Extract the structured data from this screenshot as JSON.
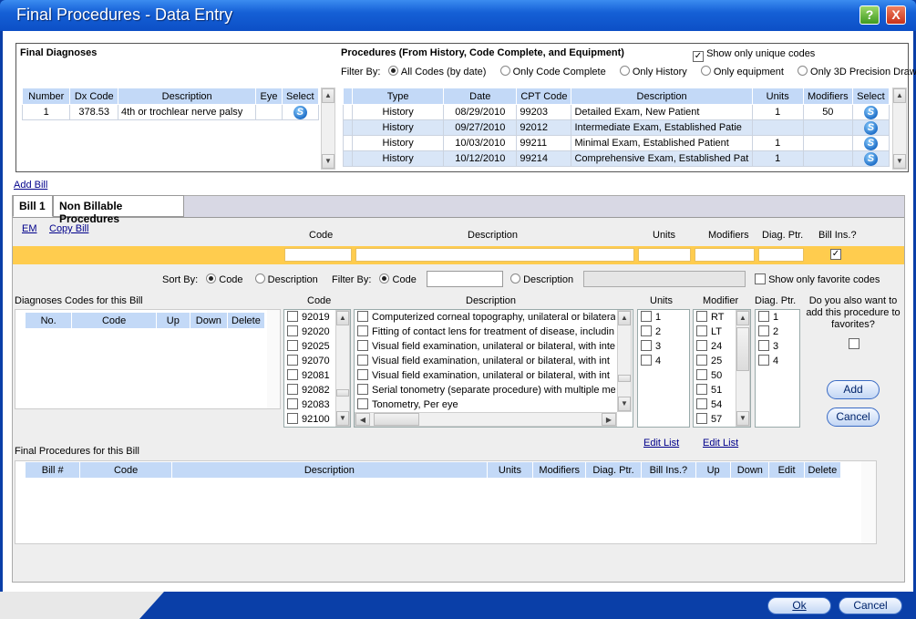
{
  "window": {
    "title": "Final Procedures - Data Entry",
    "help": "?",
    "close": "X"
  },
  "diagnoses": {
    "title": "Final Diagnoses",
    "columns": [
      "Number",
      "Dx Code",
      "Description",
      "Eye",
      "Select"
    ],
    "rows": [
      {
        "number": "1",
        "dx": "378.53",
        "desc": "4th or trochlear nerve palsy",
        "eye": ""
      }
    ]
  },
  "procedures": {
    "title": "Procedures (From History, Code Complete, and Equipment)",
    "show_unique": "Show only unique codes",
    "filter_label": "Filter By:",
    "filters": [
      "All Codes (by date)",
      "Only Code Complete",
      "Only History",
      "Only equipment",
      "Only 3D Precision Draw"
    ],
    "columns": [
      "Type",
      "Date",
      "CPT Code",
      "Description",
      "Units",
      "Modifiers",
      "Select"
    ],
    "rows": [
      {
        "type": "History",
        "date": "08/29/2010",
        "cpt": "99203",
        "desc": "Detailed Exam, New Patient",
        "units": "1",
        "mod": "50"
      },
      {
        "type": "History",
        "date": "09/27/2010",
        "cpt": "92012",
        "desc": "Intermediate  Exam,  Established Patie",
        "units": "",
        "mod": ""
      },
      {
        "type": "History",
        "date": "10/03/2010",
        "cpt": "99211",
        "desc": "Minimal Exam, Established Patient",
        "units": "1",
        "mod": ""
      },
      {
        "type": "History",
        "date": "10/12/2010",
        "cpt": "99214",
        "desc": "Comprehensive  Exam,  Established Pat",
        "units": "1",
        "mod": ""
      }
    ]
  },
  "add_bill": "Add Bill",
  "tabs": [
    "Bill 1",
    "Non Billable Procedures"
  ],
  "links": {
    "em": "EM",
    "copy_bill": "Copy Bill",
    "edit_list1": "Edit List",
    "edit_list2": "Edit List"
  },
  "entry_headers": {
    "code": "Code",
    "description": "Description",
    "units": "Units",
    "modifiers": "Modifiers",
    "diag": "Diag. Ptr.",
    "billins": "Bill Ins.?"
  },
  "sort": {
    "label": "Sort By:",
    "code": "Code",
    "description": "Description"
  },
  "filter": {
    "label": "Filter By:",
    "code": "Code",
    "description": "Description",
    "favorites": "Show only favorite codes"
  },
  "diag_codes": {
    "title": "Diagnoses Codes for this Bill",
    "columns": [
      "No.",
      "Code",
      "Up",
      "Down",
      "Delete"
    ]
  },
  "lists": {
    "code_header": "Code",
    "desc_header": "Description",
    "units_header": "Units",
    "modifier_header": "Modifier",
    "diag_header": "Diag. Ptr.",
    "codes": [
      "92019",
      "92020",
      "92025",
      "92070",
      "92081",
      "92082",
      "92083",
      "92100"
    ],
    "descriptions": [
      "Computerized corneal topography, unilateral or bilatera",
      "Fitting of contact lens for treatment of disease, includin",
      "Visual field examination, unilateral or bilateral, with inte",
      "Visual field examination, unilateral or bilateral, with int",
      "Visual field examination, unilateral or bilateral, with int",
      "Serial tonometry (separate procedure) with multiple me",
      "Tonometry, Per eye"
    ],
    "units": [
      "1",
      "2",
      "3",
      "4"
    ],
    "modifiers": [
      "RT",
      "LT",
      "24",
      "25",
      "50",
      "51",
      "54",
      "57"
    ],
    "diag": [
      "1",
      "2",
      "3",
      "4"
    ]
  },
  "favorites_q": "Do you also want to add this procedure to favorites?",
  "buttons": {
    "add": "Add",
    "cancel": "Cancel",
    "ok": "Ok",
    "cancel_bottom": "Cancel"
  },
  "final_procs": {
    "title": "Final Procedures for this Bill",
    "columns": [
      "Bill #",
      "Code",
      "Description",
      "Units",
      "Modifiers",
      "Diag. Ptr.",
      "Bill Ins.?",
      "Up",
      "Down",
      "Edit",
      "Delete"
    ]
  }
}
